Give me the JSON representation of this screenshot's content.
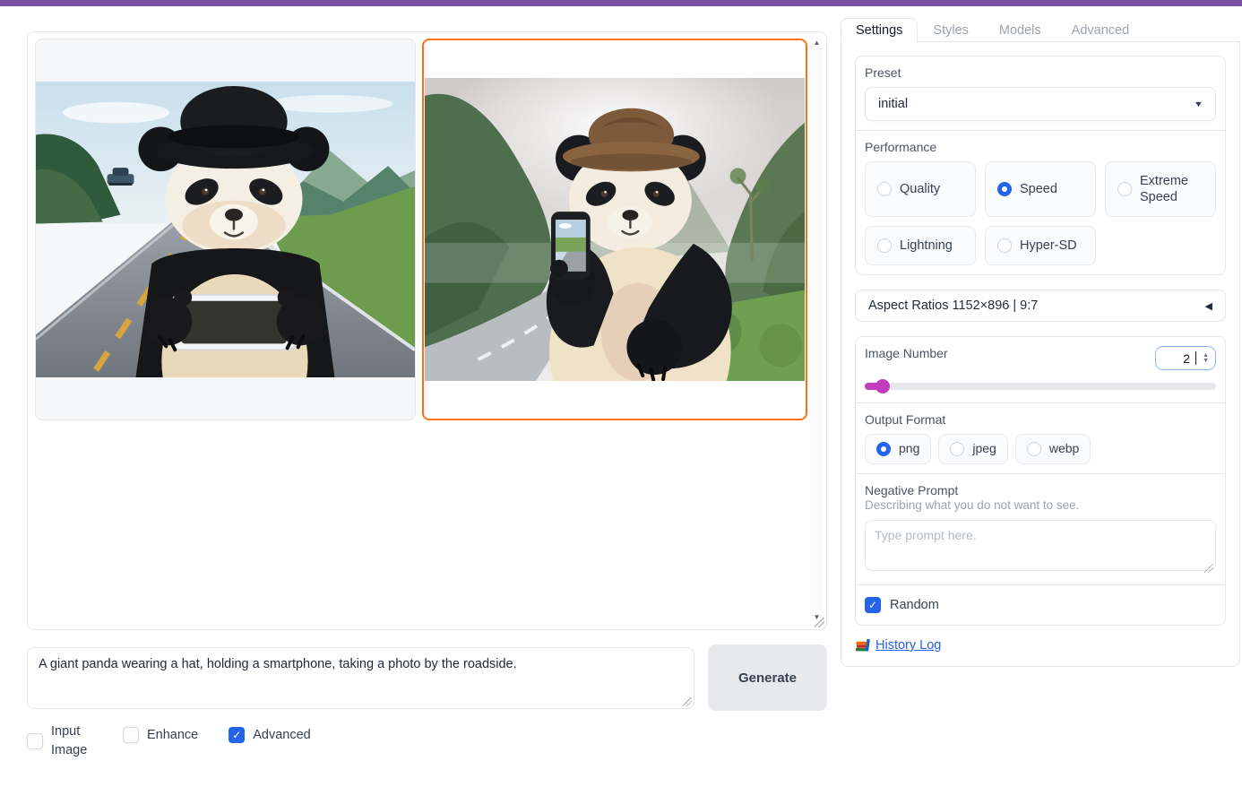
{
  "colors": {
    "topbar": "#7a4fa3",
    "selection_orange": "#f97316",
    "radio_blue": "#2563eb",
    "slider_magenta": "#c23cc2",
    "border": "#e5e7eb"
  },
  "icons": {
    "caret": "▼",
    "accordion_arrow": "◀",
    "spin_up": "▲",
    "spin_down": "▼",
    "scroll_up": "▲",
    "scroll_down": "▼",
    "check": "✓"
  },
  "gallery": {
    "images": [
      {
        "alt": "Generated image 1: giant panda in a black hat holding a smartphone horizontally beside a road",
        "selected": false
      },
      {
        "alt": "Generated image 2: giant panda in a brown hat holding a smartphone upright on a mountain road",
        "selected": true
      }
    ]
  },
  "prompt": {
    "value": "A giant panda wearing a hat, holding a smartphone, taking a photo by the roadside.",
    "generate_label": "Generate"
  },
  "options": [
    {
      "label": "Input Image",
      "checked": false
    },
    {
      "label": "Enhance",
      "checked": false
    },
    {
      "label": "Advanced",
      "checked": true
    }
  ],
  "panel": {
    "tabs": [
      {
        "label": "Settings",
        "active": true
      },
      {
        "label": "Styles",
        "active": false
      },
      {
        "label": "Models",
        "active": false
      },
      {
        "label": "Advanced",
        "active": false
      }
    ],
    "preset": {
      "label": "Preset",
      "value": "initial"
    },
    "performance": {
      "label": "Performance",
      "options": [
        {
          "label": "Quality",
          "selected": false
        },
        {
          "label": "Speed",
          "selected": true
        },
        {
          "label": "Extreme Speed",
          "selected": false
        },
        {
          "label": "Lightning",
          "selected": false
        },
        {
          "label": "Hyper-SD",
          "selected": false
        }
      ]
    },
    "aspect_ratios": {
      "label": "Aspect Ratios 1152×896 | 9:7"
    },
    "image_number": {
      "label": "Image Number",
      "value": "2",
      "slider_percent": 4
    },
    "output_format": {
      "label": "Output Format",
      "options": [
        {
          "label": "png",
          "selected": true
        },
        {
          "label": "jpeg",
          "selected": false
        },
        {
          "label": "webp",
          "selected": false
        }
      ]
    },
    "negative_prompt": {
      "label": "Negative Prompt",
      "info": "Describing what you do not want to see.",
      "placeholder": "Type prompt here.",
      "value": ""
    },
    "random": {
      "label": "Random",
      "checked": true
    },
    "history_log": {
      "label": "History Log"
    }
  }
}
